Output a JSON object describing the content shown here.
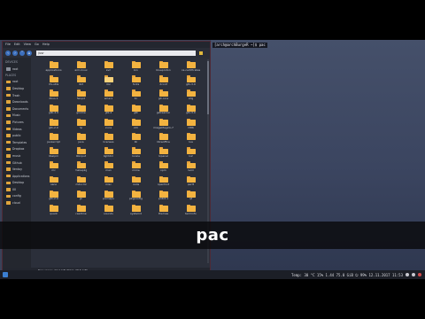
{
  "file_manager": {
    "menu": [
      "File",
      "Edit",
      "View",
      "Go",
      "Help"
    ],
    "path": "/usr",
    "sidebar_heads": [
      "DEVICES",
      "PLACES"
    ],
    "devices": [
      "root"
    ],
    "places": [
      "root",
      "Desktop",
      "Trash",
      "Downloads",
      "Documents",
      "Music",
      "Pictures",
      "Videos",
      "public",
      "Templates",
      "Dropbox",
      "music",
      "Github",
      "Ventoy",
      "Applications",
      "Desktop",
      "00",
      "config",
      "cloud"
    ],
    "folders": [
      "applications",
      "arm-linux",
      "avrl",
      "bin",
      "blueproton",
      "ca-certificates",
      "cfs-utils",
      "dict",
      "doc",
      "fonts",
      "dconf",
      "gtk-3.0",
      "dbus-1",
      "fwupd",
      "emacs",
      "lto",
      "git-core",
      "xdg",
      "glib-2.0",
      "gnome",
      "gtk-2",
      "gtk",
      "gstreamer",
      "gtk-3.0",
      "gtk-2.0",
      "hp",
      "icons",
      "info",
      "imageMagick-7",
      "i386",
      "javascript",
      "java",
      "licenses",
      "lib",
      "libreoffice",
      "lua",
      "libalpm",
      "libinput",
      "lightdm",
      "locale",
      "lxpanel",
      "lv2",
      "mc",
      "makepkg",
      "man",
      "mime",
      "npm",
      "nvim",
      "nano",
      "mdocml",
      "misc",
      "node",
      "openfont",
      "perl5",
      "gtk-2.0",
      "gir",
      "pixmaps",
      "pkgconfig",
      "polkit-1",
      "qt",
      "quark",
      "readline",
      "sounds",
      "systemd",
      "themes",
      "terminfo"
    ],
    "status": "Free space: 27.4 GiB (Total: 38.5 GiB)"
  },
  "terminal": {
    "title": "[arch@archBurgeR ~]$ pac"
  },
  "taskbar": {
    "status": "Temp: 30 °C  15%  1.44  75.0 GiB  ⏻ 99%  12.11.2017  11:53"
  },
  "caption": {
    "text": "pac"
  },
  "colors": {
    "folder": "#f3b340",
    "desktop": "#3b4560",
    "accent": "#3b7fd0"
  }
}
